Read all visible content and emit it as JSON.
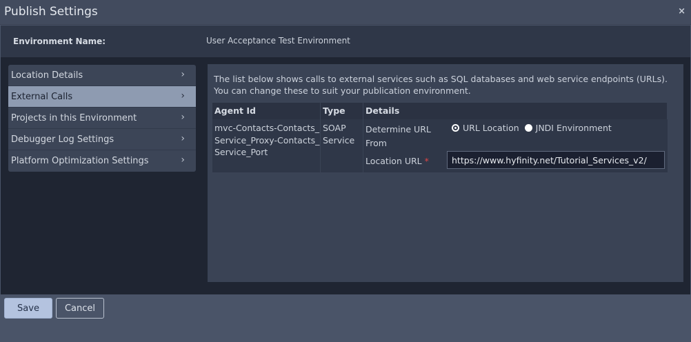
{
  "window": {
    "title": "Publish Settings",
    "close_glyph": "×"
  },
  "environment": {
    "label": "Environment Name:",
    "value": "User Acceptance Test Environment"
  },
  "nav": {
    "items": [
      {
        "label": "Location Details",
        "active": false
      },
      {
        "label": "External Calls",
        "active": true
      },
      {
        "label": "Projects in this Environment",
        "active": false
      },
      {
        "label": "Debugger Log Settings",
        "active": false
      },
      {
        "label": "Platform Optimization Settings",
        "active": false
      }
    ],
    "chevron": "›"
  },
  "panel": {
    "intro": "The list below shows calls to external services such as SQL databases and web service endpoints (URLs). You can change these to suit your publication environment.",
    "table": {
      "headers": [
        "Agent Id",
        "Type",
        "Details"
      ],
      "rows": [
        {
          "agent_id": "mvc-Contacts-Contacts_Service_Proxy-Contacts_Service_Port",
          "type": "SOAP Service",
          "determine_label": "Determine URL From",
          "options": [
            {
              "label": "URL Location",
              "selected": true
            },
            {
              "label": "JNDI Environment",
              "selected": false
            }
          ],
          "location_label": "Location URL",
          "required_mark": "*",
          "location_value": "https://www.hyfinity.net/Tutorial_Services_v2/"
        }
      ]
    }
  },
  "footer": {
    "save_label": "Save",
    "cancel_label": "Cancel"
  },
  "colors": {
    "accent": "#b4c3df",
    "active_nav": "#8e9bb1",
    "required": "#e04545"
  }
}
